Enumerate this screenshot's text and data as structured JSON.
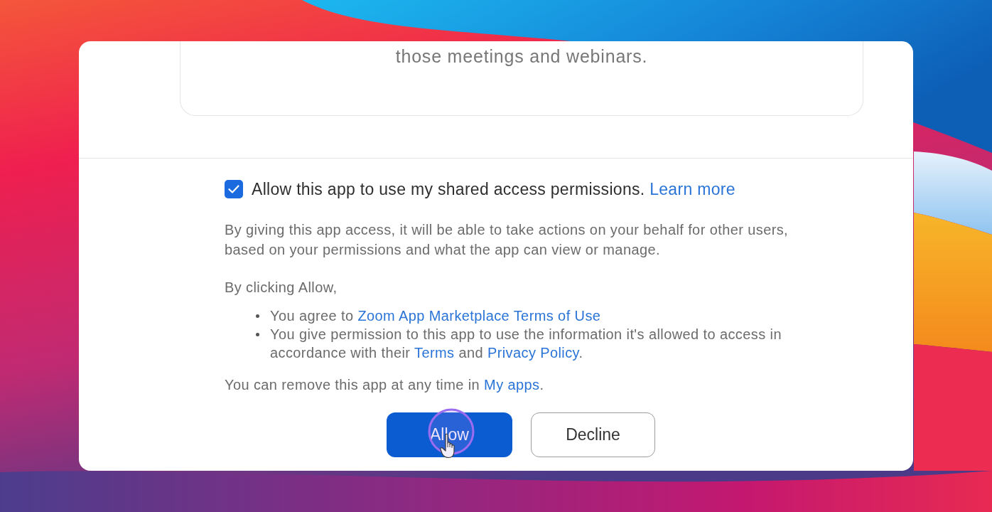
{
  "description_card": {
    "text": "those meetings and webinars."
  },
  "permission_checkbox": {
    "checked": true,
    "label": "Allow this app to use my shared access permissions.",
    "link": "Learn more"
  },
  "explanation": "By giving this app access, it will be able to take actions on your behalf for other users, based on your permissions and what the app can view or manage.",
  "agreement": {
    "intro": "By clicking Allow,",
    "items": [
      {
        "parts": [
          {
            "kind": "text",
            "text": "You agree to "
          },
          {
            "kind": "link",
            "text": "Zoom App Marketplace Terms of Use"
          }
        ]
      },
      {
        "parts": [
          {
            "kind": "text",
            "text": "You give permission to this app to use the information it's allowed to access in accordance with their "
          },
          {
            "kind": "link",
            "text": "Terms"
          },
          {
            "kind": "text",
            "text": " and "
          },
          {
            "kind": "link",
            "text": "Privacy Policy"
          },
          {
            "kind": "text",
            "text": "."
          }
        ]
      }
    ]
  },
  "removal_note": {
    "parts": [
      {
        "kind": "text",
        "text": "You can remove this app at any time in "
      },
      {
        "kind": "link",
        "text": "My apps"
      },
      {
        "kind": "text",
        "text": "."
      }
    ]
  },
  "buttons": [
    {
      "label": "Allow",
      "kind": "primary"
    },
    {
      "label": "Decline",
      "kind": "secondary"
    }
  ]
}
